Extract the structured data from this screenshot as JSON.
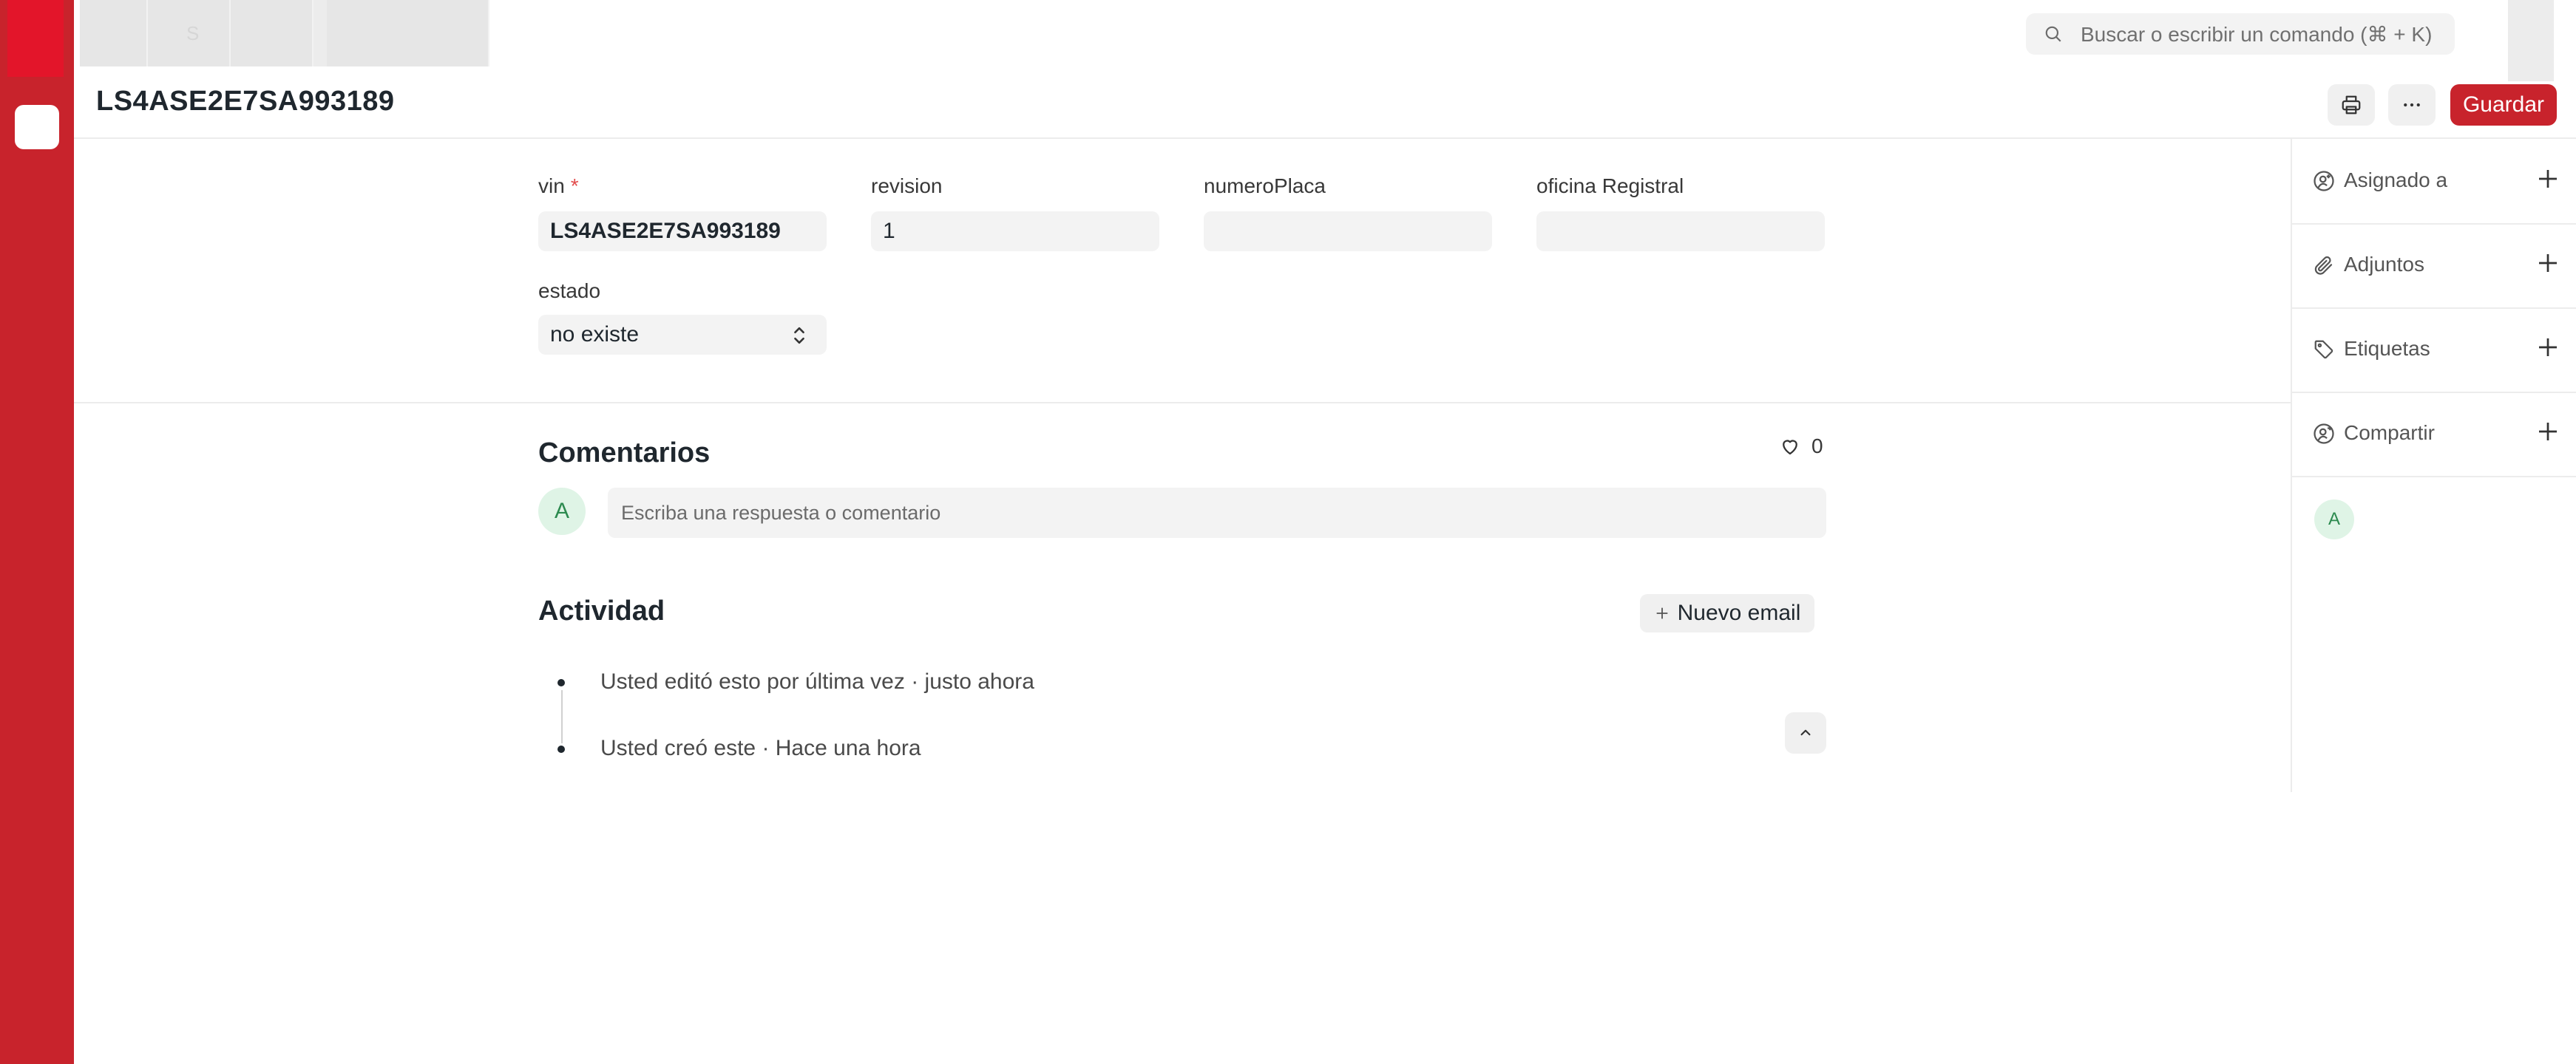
{
  "top": {
    "tab_label": "S",
    "search_placeholder": "Buscar o escribir un comando (⌘ + K)"
  },
  "header": {
    "title": "LS4ASE2E7SA993189",
    "save_label": "Guardar"
  },
  "form": {
    "fields": [
      {
        "label": "vin",
        "required_mark": "*",
        "value": "LS4ASE2E7SA993189"
      },
      {
        "label": "revision",
        "value": "1"
      },
      {
        "label": "numeroPlaca",
        "value": ""
      },
      {
        "label": "oficina Registral",
        "value": ""
      }
    ],
    "estado": {
      "label": "estado",
      "value": "no existe"
    }
  },
  "sidebar": {
    "items": [
      {
        "label": "Asignado a",
        "icon": "user-plus-icon"
      },
      {
        "label": "Adjuntos",
        "icon": "paperclip-icon"
      },
      {
        "label": "Etiquetas",
        "icon": "tag-icon"
      },
      {
        "label": "Compartir",
        "icon": "share-user-icon"
      }
    ],
    "avatar_initial": "A"
  },
  "comments": {
    "title": "Comentarios",
    "like_count": "0",
    "avatar_initial": "A",
    "placeholder": "Escriba una respuesta o comentario"
  },
  "activity": {
    "title": "Actividad",
    "new_email_label": "Nuevo email",
    "items": [
      {
        "text": "Usted editó esto por última vez · justo ahora"
      },
      {
        "text": "Usted creó este · Hace una hora"
      }
    ]
  },
  "colors": {
    "brand": "#c8232c",
    "rail_logo": "#e3152a",
    "avatar_bg": "#dff4e6",
    "avatar_text": "#2c8a4f"
  }
}
